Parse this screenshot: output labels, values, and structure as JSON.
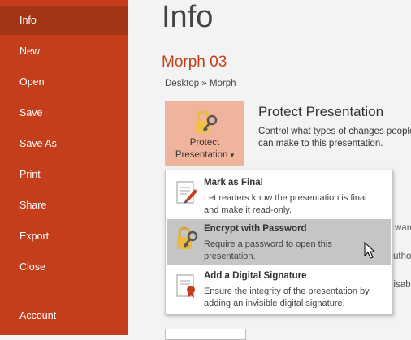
{
  "sidebar": {
    "items": [
      {
        "label": "Info"
      },
      {
        "label": "New"
      },
      {
        "label": "Open"
      },
      {
        "label": "Save"
      },
      {
        "label": "Save As"
      },
      {
        "label": "Print"
      },
      {
        "label": "Share"
      },
      {
        "label": "Export"
      },
      {
        "label": "Close"
      },
      {
        "label": "Account"
      }
    ],
    "active": "Info"
  },
  "main": {
    "title": "Info",
    "doc_title": "Morph 03",
    "breadcrumb": "Desktop » Morph",
    "protect": {
      "button_line1": "Protect",
      "button_line2": "Presentation",
      "caret": "▾",
      "heading": "Protect Presentation",
      "description": "Control what types of changes people can make to this presentation."
    },
    "background_fragments": [
      "ware",
      "utho",
      "lisab"
    ]
  },
  "menu": {
    "items": [
      {
        "title": "Mark as Final",
        "description": "Let readers know the presentation is final and make it read-only.",
        "icon": "mark-final-icon"
      },
      {
        "title": "Encrypt with Password",
        "description": "Require a password to open this presentation.",
        "icon": "lock-key-icon"
      },
      {
        "title": "Add a Digital Signature",
        "description": "Ensure the integrity of the presentation by adding an invisible digital signature.",
        "icon": "signature-icon"
      }
    ],
    "highlighted": "Encrypt with Password"
  },
  "colors": {
    "sidebar_bg": "#c43e1c",
    "sidebar_active": "#a33416",
    "accent": "#c43e1c",
    "protect_button_bg": "#f0b49c",
    "menu_highlight": "#c5c5c5"
  }
}
